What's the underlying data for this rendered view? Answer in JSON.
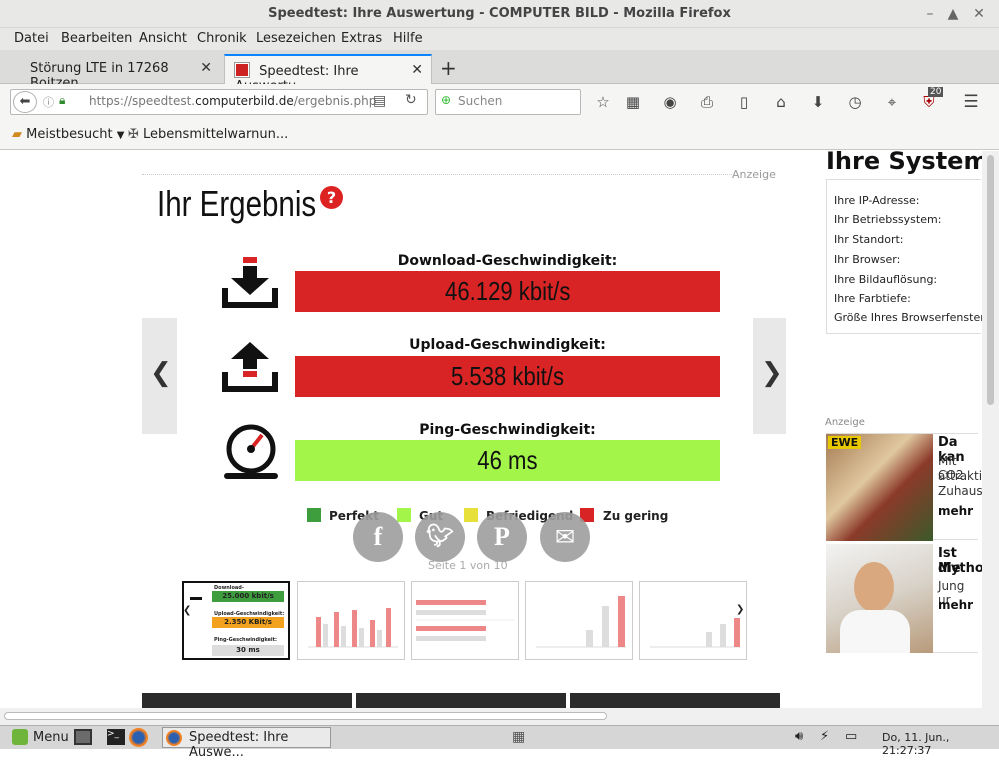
{
  "window": {
    "title": "Speedtest: Ihre Auswertung - COMPUTER BILD - Mozilla Firefox"
  },
  "menu": [
    "Datei",
    "Bearbeiten",
    "Ansicht",
    "Chronik",
    "Lesezeichen",
    "Extras",
    "Hilfe"
  ],
  "tabs": [
    {
      "label": "Störung LTE in 17268 Boitzen..."
    },
    {
      "label": "Speedtest: Ihre Auswertu..."
    }
  ],
  "nav": {
    "url_prefix": "https://speedtest.",
    "url_domain": "computerbild.de",
    "url_path": "/ergebnis.php",
    "search_placeholder": "Suchen",
    "ublock_count": "20"
  },
  "bookmarks": [
    {
      "label": "Meistbesucht"
    },
    {
      "label": "Lebensmittelwarnun..."
    }
  ],
  "page": {
    "anzeige": "Anzeige",
    "heading": "Ihr Ergebnis",
    "download_label": "Download-Geschwindigkeit:",
    "download_value": "46.129 kbit/s",
    "upload_label": "Upload-Geschwindigkeit:",
    "upload_value": "5.538 kbit/s",
    "ping_label": "Ping-Geschwindigkeit:",
    "ping_value": "46 ms",
    "legend": [
      {
        "label": "Perfekt",
        "color": "#3e9e3e"
      },
      {
        "label": "Gut",
        "color": "#a4f54a"
      },
      {
        "label": "Befriedigend",
        "color": "#e8e03a"
      },
      {
        "label": "Zu gering",
        "color": "#d82424"
      }
    ],
    "pager": "Seite 1 von 10",
    "thumb1": {
      "download_label": "Download-Geschwindigkeit:",
      "download_value": "25.000 kbit/s",
      "upload_label": "Upload-Geschwindigkeit:",
      "upload_value": "2.350 KBit/s",
      "ping_label": "Ping-Geschwindigkeit:",
      "ping_value": "30 ms"
    },
    "colors": {
      "red": "#d82424",
      "green": "#a4f54a"
    }
  },
  "sidebar": {
    "title": "Ihre Systeme",
    "rows": [
      "Ihre IP-Adresse:",
      "Ihr Betriebssystem:",
      "Ihr Standort:",
      "Ihr Browser:",
      "Ihre Bildauflösung:",
      "Ihre Farbtiefe:",
      "Größe Ihres Browserfensters:"
    ],
    "anzeige": "Anzeige",
    "ad1": {
      "title": "Da kan",
      "lines": [
        "Mit CO2",
        "attrakti",
        "Zuhaus"
      ],
      "more": "mehr",
      "badge": "EWE"
    },
    "ad2": {
      "title": "Ist die",
      "title2": "Mythos",
      "lines": [
        "Jung ur"
      ],
      "more": "mehr"
    }
  },
  "taskbar": {
    "menu": "Menu",
    "window": "Speedtest: Ihre Auswe...",
    "clock": "Do, 11. Jun., 21:27:37"
  }
}
